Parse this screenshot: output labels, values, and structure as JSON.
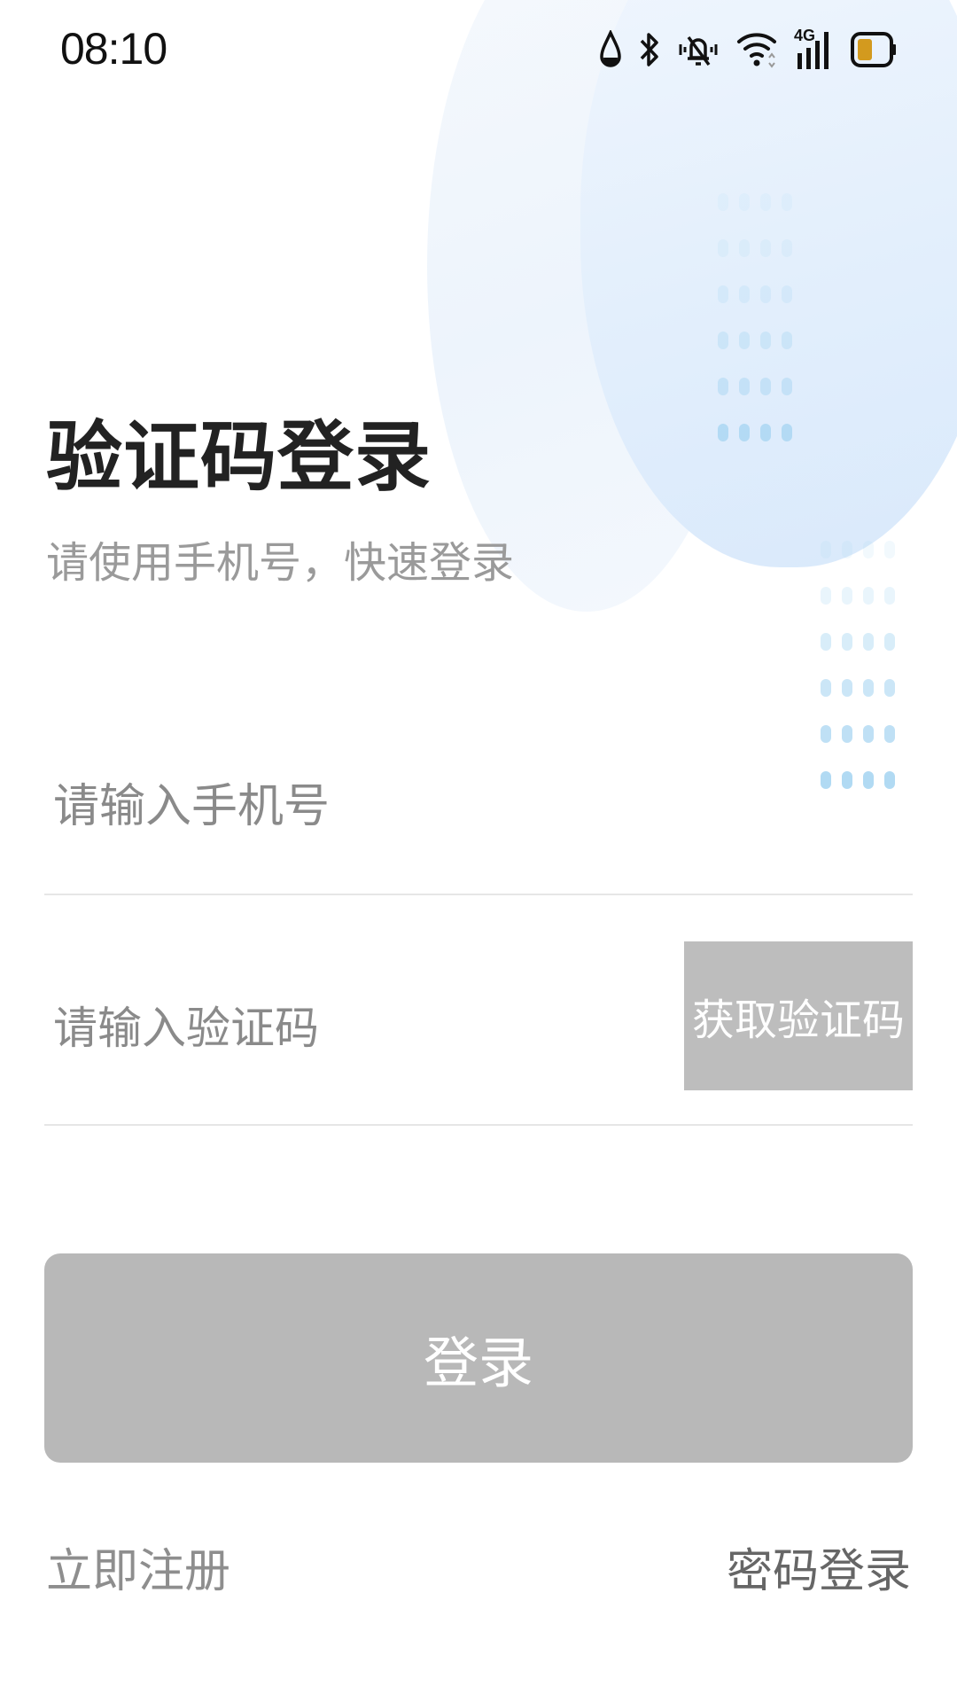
{
  "status_bar": {
    "time": "08:10",
    "network_label": "4G",
    "icons": [
      "data-saver-icon",
      "bluetooth-icon",
      "vibrate-mute-icon",
      "wifi-icon",
      "cellular-4g-icon",
      "battery-icon"
    ],
    "battery_color": "#d39a1e"
  },
  "header": {
    "title": "验证码登录",
    "subtitle": "请使用手机号，快速登录"
  },
  "form": {
    "phone_placeholder": "请输入手机号",
    "code_placeholder": "请输入验证码",
    "get_code_label": "获取验证码",
    "login_label": "登录"
  },
  "footer": {
    "register_label": "立即注册",
    "password_login_label": "密码登录"
  },
  "colors": {
    "button_disabled": "#b8b8b8",
    "get_code_disabled": "#bdbdbd",
    "title_text": "#222222",
    "hint_text": "#9a9a9a",
    "decor_blue": "#a9d6f2"
  }
}
